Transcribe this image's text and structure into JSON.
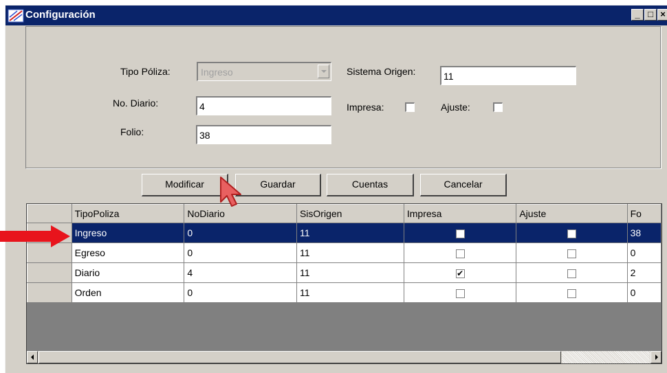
{
  "window": {
    "title": "Configuración",
    "min_glyph": "_",
    "max_glyph": "□",
    "close_glyph": "×"
  },
  "form": {
    "tipo_poliza_label": "Tipo Póliza:",
    "tipo_poliza_value": "Ingreso",
    "no_diario_label": "No. Diario:",
    "no_diario_value": "4",
    "folio_label": "Folio:",
    "folio_value": "38",
    "sistema_origen_label": "Sistema Origen:",
    "sistema_origen_value": "11",
    "impresa_label": "Impresa:",
    "ajuste_label": "Ajuste:"
  },
  "buttons": {
    "modificar": "Modificar",
    "guardar": "Guardar",
    "cuentas": "Cuentas",
    "cancelar": "Cancelar"
  },
  "grid": {
    "columns": [
      "TipoPoliza",
      "NoDiario",
      "SisOrigen",
      "Impresa",
      "Ajuste",
      "Fo"
    ],
    "rows": [
      {
        "tipo": "Ingreso",
        "nodiario": "0",
        "sisorigen": "11",
        "impresa": false,
        "ajuste": false,
        "folio": "38",
        "selected": true
      },
      {
        "tipo": "Egreso",
        "nodiario": "0",
        "sisorigen": "11",
        "impresa": false,
        "ajuste": false,
        "folio": "0",
        "selected": false
      },
      {
        "tipo": "Diario",
        "nodiario": "4",
        "sisorigen": "11",
        "impresa": true,
        "ajuste": false,
        "folio": "2",
        "selected": false
      },
      {
        "tipo": "Orden",
        "nodiario": "0",
        "sisorigen": "11",
        "impresa": false,
        "ajuste": false,
        "folio": "0",
        "selected": false
      }
    ]
  },
  "colors": {
    "titlebar": "#0a246a",
    "selection": "#0a246a",
    "face": "#d4d0c8",
    "arrow": "#e8141c"
  }
}
